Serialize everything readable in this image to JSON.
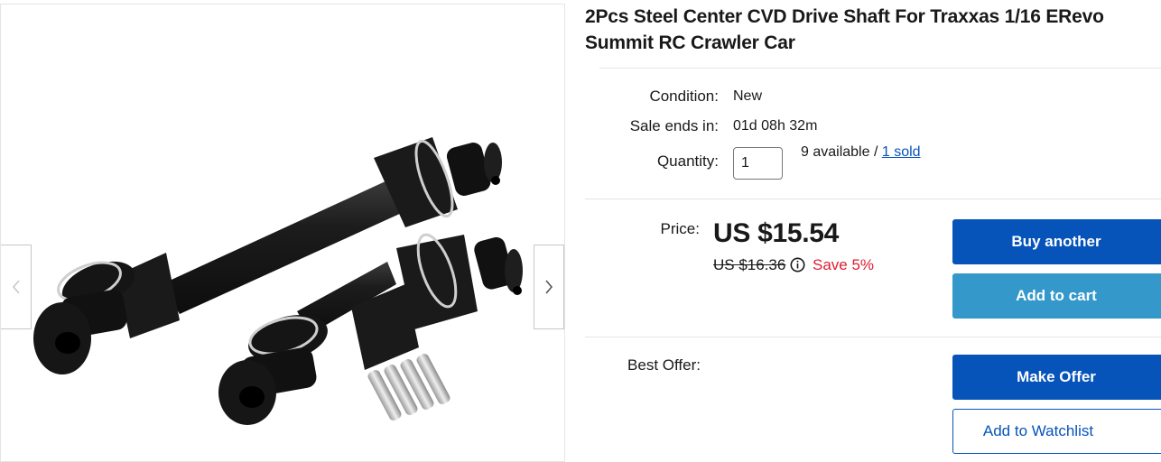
{
  "listing": {
    "title": "2Pcs Steel Center CVD Drive Shaft For Traxxas 1/16 ERevo Summit RC Crawler Car"
  },
  "details": {
    "condition_label": "Condition:",
    "condition_value": "New",
    "sale_ends_label": "Sale ends in:",
    "sale_ends_value": "01d 08h 32m",
    "quantity_label": "Quantity:",
    "quantity_value": "1",
    "available_text": "9 available / ",
    "sold_link": "1 sold"
  },
  "pricing": {
    "price_label": "Price:",
    "price": "US $15.54",
    "original_price": "US $16.36",
    "save_text": "Save 5%"
  },
  "actions": {
    "buy_another": "Buy another",
    "add_to_cart": "Add to cart",
    "best_offer_label": "Best Offer:",
    "make_offer": "Make Offer",
    "add_to_watchlist": "Add to Watchlist"
  },
  "gallery": {
    "prev_icon": "chevron-left-icon",
    "next_icon": "chevron-right-icon"
  },
  "colors": {
    "primary_blue": "#0654ba",
    "secondary_blue": "#3498ca",
    "save_red": "#dd1e31"
  }
}
